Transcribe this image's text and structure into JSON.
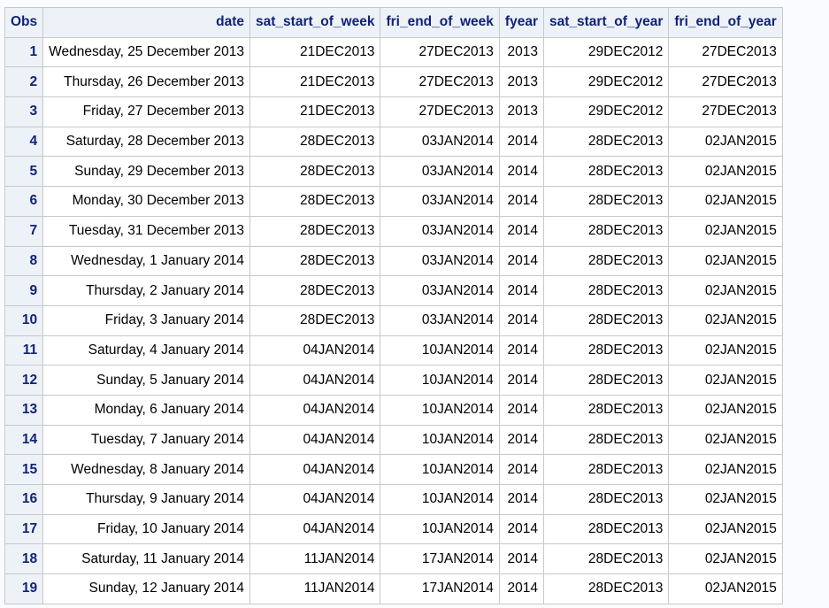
{
  "table": {
    "columns": [
      "Obs",
      "date",
      "sat_start_of_week",
      "fri_end_of_week",
      "fyear",
      "sat_start_of_year",
      "fri_end_of_year"
    ],
    "rows": [
      [
        "1",
        "Wednesday, 25 December 2013",
        "21DEC2013",
        "27DEC2013",
        "2013",
        "29DEC2012",
        "27DEC2013"
      ],
      [
        "2",
        "Thursday, 26 December 2013",
        "21DEC2013",
        "27DEC2013",
        "2013",
        "29DEC2012",
        "27DEC2013"
      ],
      [
        "3",
        "Friday, 27 December 2013",
        "21DEC2013",
        "27DEC2013",
        "2013",
        "29DEC2012",
        "27DEC2013"
      ],
      [
        "4",
        "Saturday, 28 December 2013",
        "28DEC2013",
        "03JAN2014",
        "2014",
        "28DEC2013",
        "02JAN2015"
      ],
      [
        "5",
        "Sunday, 29 December 2013",
        "28DEC2013",
        "03JAN2014",
        "2014",
        "28DEC2013",
        "02JAN2015"
      ],
      [
        "6",
        "Monday, 30 December 2013",
        "28DEC2013",
        "03JAN2014",
        "2014",
        "28DEC2013",
        "02JAN2015"
      ],
      [
        "7",
        "Tuesday, 31 December 2013",
        "28DEC2013",
        "03JAN2014",
        "2014",
        "28DEC2013",
        "02JAN2015"
      ],
      [
        "8",
        "Wednesday, 1 January 2014",
        "28DEC2013",
        "03JAN2014",
        "2014",
        "28DEC2013",
        "02JAN2015"
      ],
      [
        "9",
        "Thursday, 2 January 2014",
        "28DEC2013",
        "03JAN2014",
        "2014",
        "28DEC2013",
        "02JAN2015"
      ],
      [
        "10",
        "Friday, 3 January 2014",
        "28DEC2013",
        "03JAN2014",
        "2014",
        "28DEC2013",
        "02JAN2015"
      ],
      [
        "11",
        "Saturday, 4 January 2014",
        "04JAN2014",
        "10JAN2014",
        "2014",
        "28DEC2013",
        "02JAN2015"
      ],
      [
        "12",
        "Sunday, 5 January 2014",
        "04JAN2014",
        "10JAN2014",
        "2014",
        "28DEC2013",
        "02JAN2015"
      ],
      [
        "13",
        "Monday, 6 January 2014",
        "04JAN2014",
        "10JAN2014",
        "2014",
        "28DEC2013",
        "02JAN2015"
      ],
      [
        "14",
        "Tuesday, 7 January 2014",
        "04JAN2014",
        "10JAN2014",
        "2014",
        "28DEC2013",
        "02JAN2015"
      ],
      [
        "15",
        "Wednesday, 8 January 2014",
        "04JAN2014",
        "10JAN2014",
        "2014",
        "28DEC2013",
        "02JAN2015"
      ],
      [
        "16",
        "Thursday, 9 January 2014",
        "04JAN2014",
        "10JAN2014",
        "2014",
        "28DEC2013",
        "02JAN2015"
      ],
      [
        "17",
        "Friday, 10 January 2014",
        "04JAN2014",
        "10JAN2014",
        "2014",
        "28DEC2013",
        "02JAN2015"
      ],
      [
        "18",
        "Saturday, 11 January 2014",
        "11JAN2014",
        "17JAN2014",
        "2014",
        "28DEC2013",
        "02JAN2015"
      ],
      [
        "19",
        "Sunday, 12 January 2014",
        "11JAN2014",
        "17JAN2014",
        "2014",
        "28DEC2013",
        "02JAN2015"
      ]
    ]
  }
}
